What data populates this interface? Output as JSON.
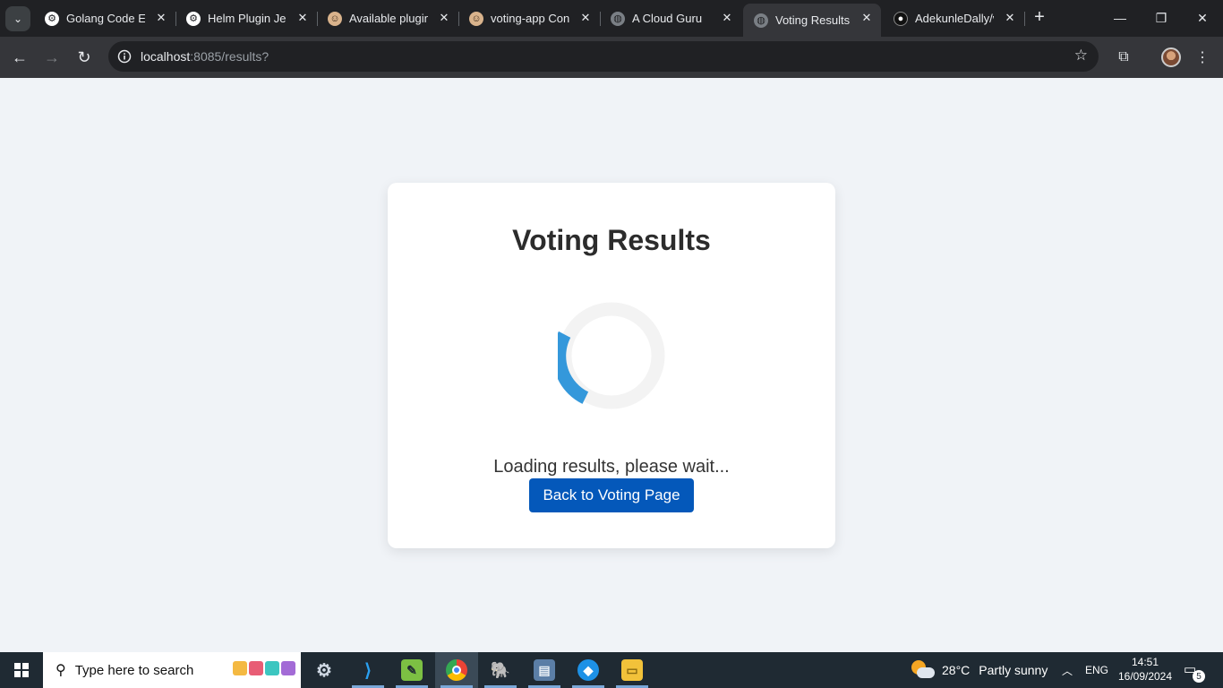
{
  "browser": {
    "tabs": [
      {
        "title": "Golang Code Exp",
        "favicon": "openai-icon",
        "active": false
      },
      {
        "title": "Helm Plugin Jenk",
        "favicon": "openai-icon",
        "active": false
      },
      {
        "title": "Available plugins",
        "favicon": "jenkins-icon",
        "active": false
      },
      {
        "title": "voting-app Conf",
        "favicon": "jenkins-icon",
        "active": false
      },
      {
        "title": "A Cloud Guru",
        "favicon": "globe-icon",
        "active": false
      },
      {
        "title": "Voting Results",
        "favicon": "globe-icon",
        "active": true
      },
      {
        "title": "AdekunleDally/v",
        "favicon": "github-icon",
        "active": false
      }
    ],
    "url": {
      "host": "localhost",
      "rest": ":8085/results?"
    }
  },
  "page": {
    "title": "Voting Results",
    "loading_text": "Loading results, please wait...",
    "back_button": "Back to Voting Page",
    "spinner": {
      "track_color": "#f3f3f3",
      "arc_color": "#3498db"
    }
  },
  "taskbar": {
    "search_placeholder": "Type here to search",
    "weather": {
      "temp": "28°C",
      "desc": "Partly sunny"
    },
    "language": "ENG",
    "time": "14:51",
    "date": "16/09/2024",
    "notification_count": "5"
  },
  "colors": {
    "accent_button": "#0458ba",
    "page_bg": "#f0f3f7"
  }
}
